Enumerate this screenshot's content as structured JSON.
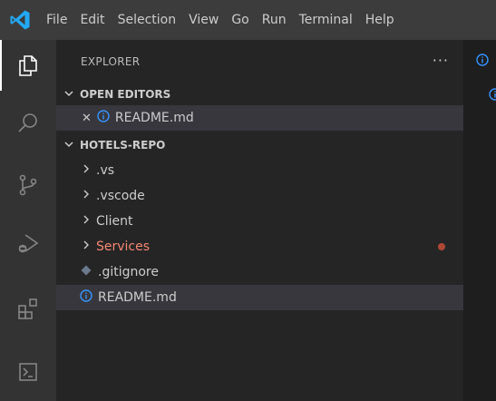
{
  "menubar": {
    "items": [
      "File",
      "Edit",
      "Selection",
      "View",
      "Go",
      "Run",
      "Terminal",
      "Help"
    ]
  },
  "activitybar": {
    "icons": [
      "explorer-icon",
      "search-icon",
      "source-control-icon",
      "run-debug-icon",
      "extensions-icon",
      "terminal-icon"
    ]
  },
  "explorer": {
    "title": "EXPLORER",
    "more_actions": "···",
    "open_editors": {
      "title": "OPEN EDITORS",
      "items": [
        {
          "name": "README.md",
          "close_glyph": "✕"
        }
      ]
    },
    "repo": {
      "title": "HOTELS-REPO",
      "items": [
        {
          "name": ".vs",
          "kind": "folder"
        },
        {
          "name": ".vscode",
          "kind": "folder"
        },
        {
          "name": "Client",
          "kind": "folder"
        },
        {
          "name": "Services",
          "kind": "folder",
          "modified": true
        },
        {
          "name": ".gitignore",
          "kind": "file"
        },
        {
          "name": "README.md",
          "kind": "file",
          "selected": true
        }
      ]
    }
  },
  "colors": {
    "menubar_bg": "#3c3c3c",
    "activitybar_bg": "#333333",
    "sidebar_bg": "#252526",
    "editor_bg": "#1e1e1e",
    "selection_bg": "#37373d",
    "info_icon": "#3794ff",
    "modified_text": "#f48771",
    "logo": "#23a9f2"
  }
}
